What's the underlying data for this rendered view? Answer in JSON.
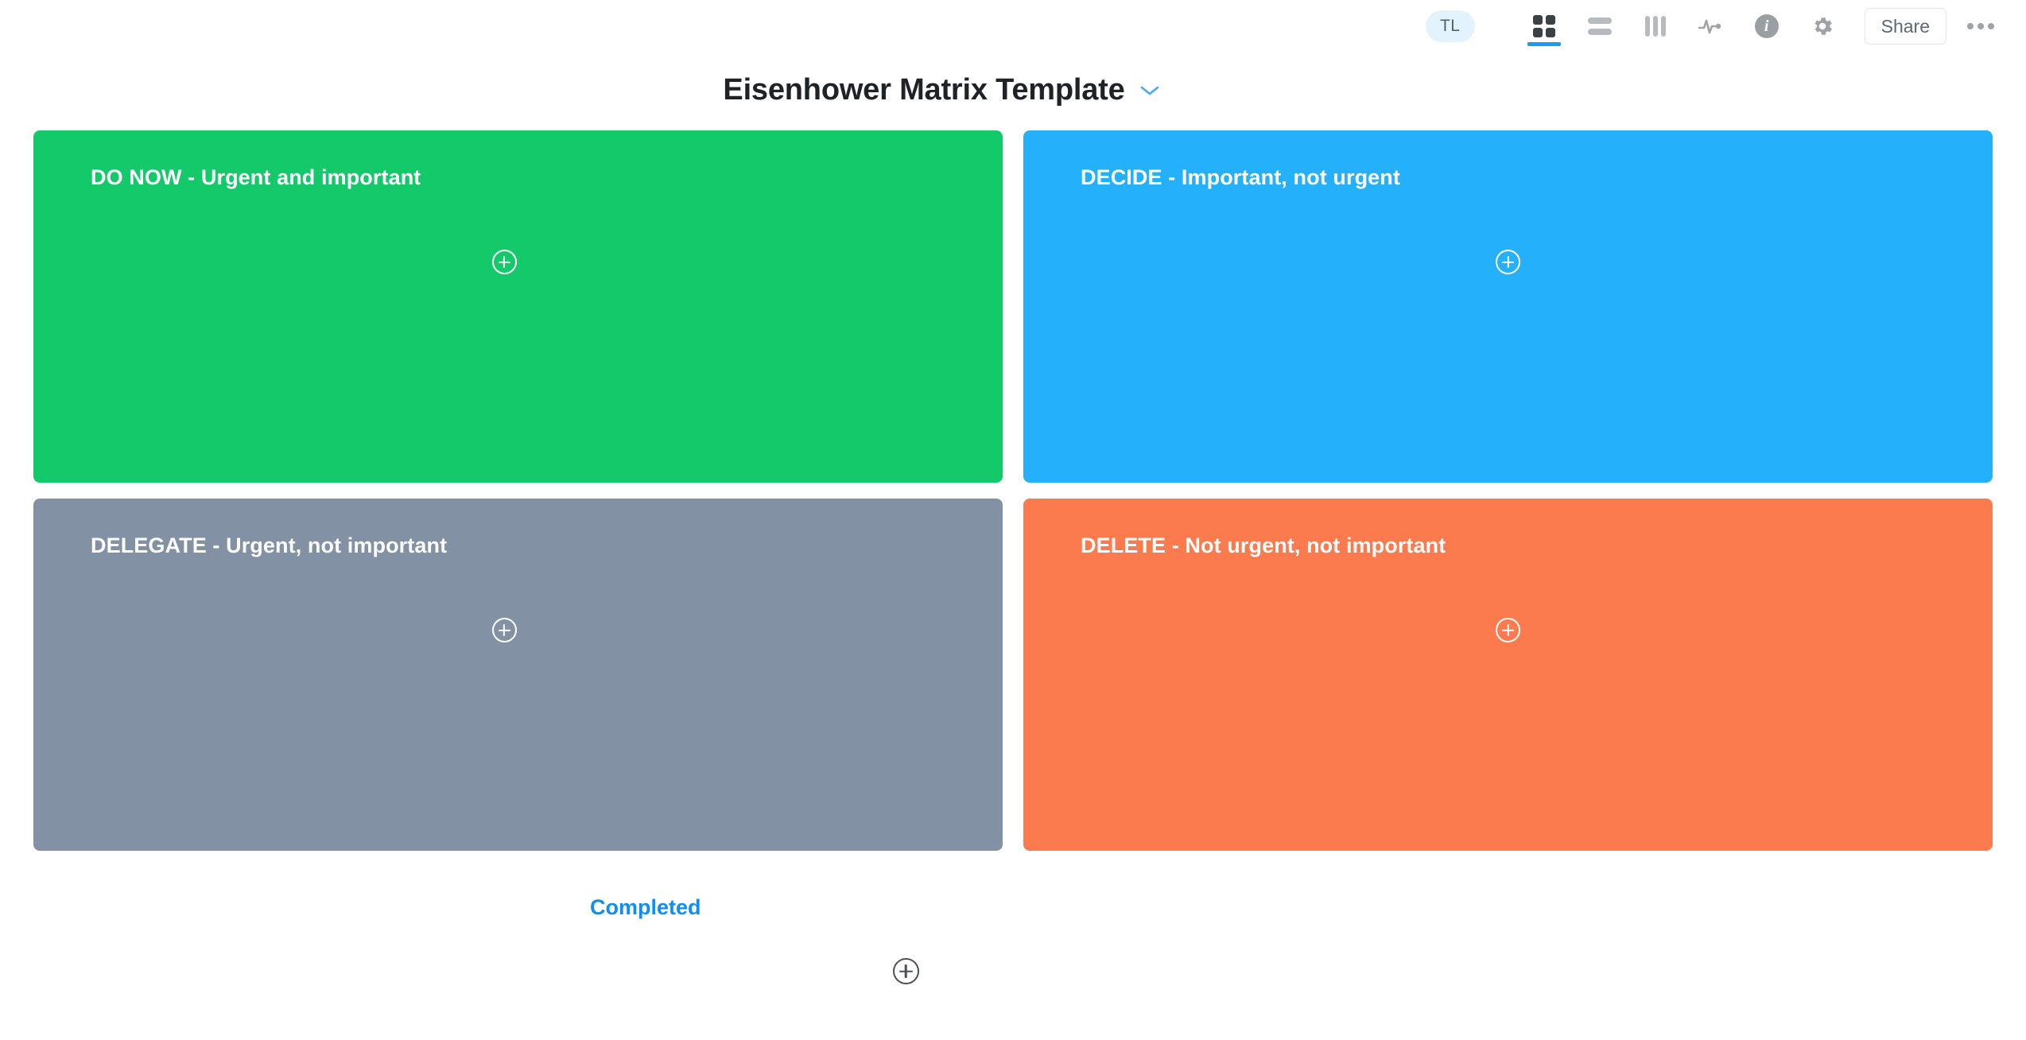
{
  "topbar": {
    "avatar_initials": "TL",
    "views": [
      {
        "name": "board-view",
        "icon": "grid-icon",
        "active": true
      },
      {
        "name": "list-view",
        "icon": "list-icon",
        "active": false
      },
      {
        "name": "columns-view",
        "icon": "columns-icon",
        "active": false
      },
      {
        "name": "activity-view",
        "icon": "pulse-icon",
        "active": false
      },
      {
        "name": "info-view",
        "icon": "info-icon",
        "active": false
      },
      {
        "name": "settings-view",
        "icon": "gear-icon",
        "active": false
      }
    ],
    "share_label": "Share",
    "more_label": "•••",
    "accent_color": "#1a9cf0"
  },
  "header": {
    "title": "Eisenhower Matrix Template",
    "caret_icon": "chevron-down-icon",
    "caret_color": "#4aa8f0"
  },
  "matrix": {
    "quadrants": [
      {
        "id": "do-now",
        "title": "DO NOW - Urgent and important",
        "color": "#14c96a",
        "add_label": "plus-circle-icon"
      },
      {
        "id": "decide",
        "title": "DECIDE - Important, not urgent",
        "color": "#24b0fb",
        "add_label": "plus-circle-icon"
      },
      {
        "id": "delegate",
        "title": "DELEGATE - Urgent, not important",
        "color": "#8291a4",
        "add_label": "plus-circle-icon"
      },
      {
        "id": "delete",
        "title": "DELETE - Not urgent, not important",
        "color": "#fb7b4e",
        "add_label": "plus-circle-icon"
      }
    ]
  },
  "completed": {
    "label": "Completed",
    "color": "#0d8ff5",
    "add_icon": "plus-circle-icon"
  }
}
